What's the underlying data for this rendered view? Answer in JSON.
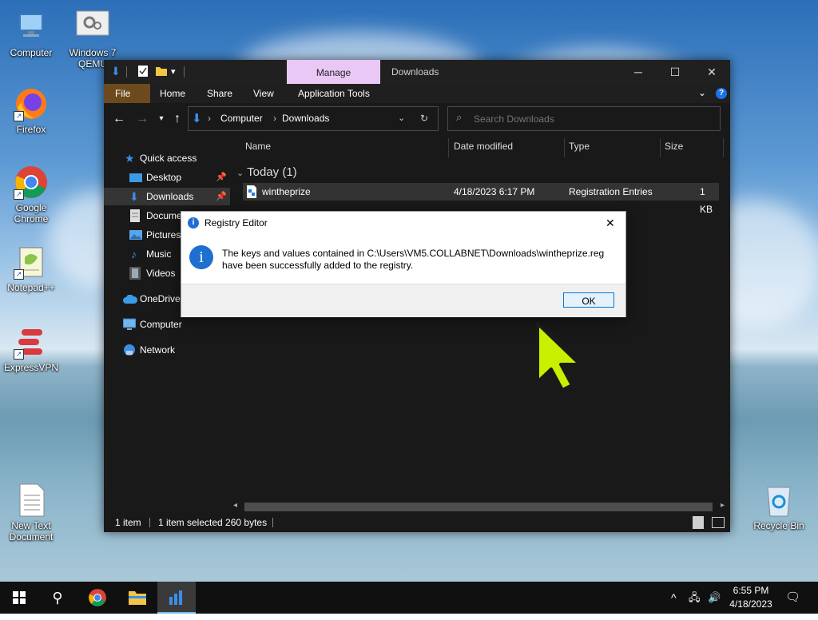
{
  "desktop": {
    "icons": [
      {
        "label": "Computer"
      },
      {
        "label": "Windows 7 QEMU"
      },
      {
        "label": "Firefox"
      },
      {
        "label": "Google Chrome"
      },
      {
        "label": "Notepad++"
      },
      {
        "label": "ExpressVPN"
      },
      {
        "label": "New Text Document"
      },
      {
        "label": "Recycle Bin"
      }
    ]
  },
  "explorer": {
    "title": "Downloads",
    "manage_tab": "Manage",
    "ribbon_tabs": [
      "File",
      "Home",
      "Share",
      "View",
      "Application Tools"
    ],
    "address": {
      "crumbs": [
        "Computer",
        "Downloads"
      ]
    },
    "search_placeholder": "Search Downloads",
    "nav": {
      "quick_access": "Quick access",
      "items": [
        "Desktop",
        "Downloads",
        "Documents",
        "Pictures",
        "Music",
        "Videos"
      ],
      "onedrive": "OneDrive",
      "computer": "Computer",
      "network": "Network"
    },
    "columns": [
      "Name",
      "Date modified",
      "Type",
      "Size"
    ],
    "group_label": "Today (1)",
    "file": {
      "name": "wintheprize",
      "date": "4/18/2023 6:17 PM",
      "type": "Registration Entries",
      "size": "1 KB"
    },
    "status": {
      "count": "1 item",
      "selected": "1 item selected  260 bytes"
    }
  },
  "dialog": {
    "title": "Registry Editor",
    "message_line1": "The keys and values contained in C:\\Users\\VM5.COLLABNET\\Downloads\\wintheprize.reg",
    "message_line2": "have been successfully added to the registry.",
    "ok_label": "OK"
  },
  "taskbar": {
    "time": "6:55 PM",
    "date": "4/18/2023"
  },
  "colors": {
    "accent": "#0078d7",
    "manage_tab": "#e9c8f6",
    "file_tab": "#6d4a1d",
    "cursor": "#c8f000"
  }
}
